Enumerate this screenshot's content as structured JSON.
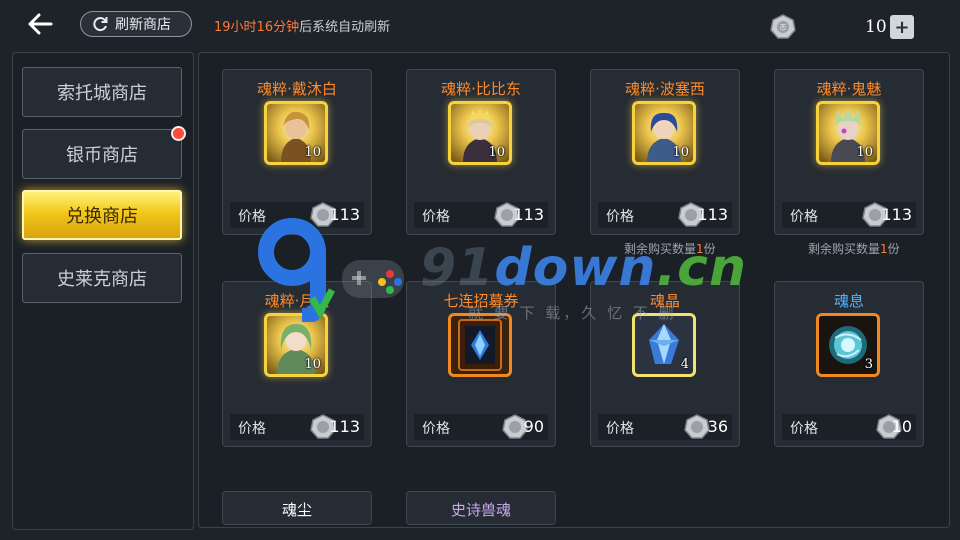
{
  "header": {
    "refresh_button_label": "刷新商店",
    "refresh_time": "19小时16分钟",
    "refresh_suffix": "后系统自动刷新",
    "currency_amount": "10",
    "add_label": "+"
  },
  "sidebar": {
    "items": [
      {
        "label": "索托城商店",
        "active": false,
        "has_notification": false
      },
      {
        "label": "银币商店",
        "active": false,
        "has_notification": true
      },
      {
        "label": "兑换商店",
        "active": true,
        "has_notification": false
      },
      {
        "label": "史莱克商店",
        "active": false,
        "has_notification": false
      }
    ]
  },
  "shop": {
    "price_label": "价格",
    "remaining_prefix": "剩余购买数量",
    "remaining_suffix": "份",
    "items": [
      {
        "name": "魂粹·戴沐白",
        "qty": "10",
        "price": "113",
        "frame": "gold",
        "icon": "hero-portrait-icon"
      },
      {
        "name": "魂粹·比比东",
        "qty": "10",
        "price": "113",
        "frame": "gold",
        "icon": "hero-portrait-icon"
      },
      {
        "name": "魂粹·波塞西",
        "qty": "10",
        "price": "113",
        "frame": "gold",
        "icon": "hero-portrait-icon",
        "remaining": "1"
      },
      {
        "name": "魂粹·鬼魅",
        "qty": "10",
        "price": "113",
        "frame": "gold",
        "icon": "hero-portrait-icon",
        "remaining": "1"
      },
      {
        "name": "魂粹·月关",
        "qty": "10",
        "price": "113",
        "frame": "gold",
        "icon": "hero-portrait-icon"
      },
      {
        "name": "七连招募券",
        "qty": "",
        "price": "90",
        "frame": "orange",
        "icon": "recruit-ticket-icon"
      },
      {
        "name": "魂晶",
        "qty": "4",
        "price": "36",
        "frame": "yellow",
        "icon": "soul-crystal-icon"
      },
      {
        "name": "魂息",
        "qty": "3",
        "price": "10",
        "frame": "orange",
        "icon": "soul-breath-icon"
      }
    ],
    "bottom_items": [
      {
        "name": "魂尘"
      },
      {
        "name": "史诗兽魂"
      }
    ]
  },
  "watermark": {
    "text_prefix": "91",
    "text_down": "down",
    "text_cn": ".cn",
    "subtitle": "就 要 下 载，久 忆 不 删"
  },
  "colors": {
    "accent_orange": "#ff8a2a",
    "accent_blue": "#4db4ff",
    "active_tab_gold": "#f2c81a",
    "notification_red": "#ff4b3a"
  }
}
